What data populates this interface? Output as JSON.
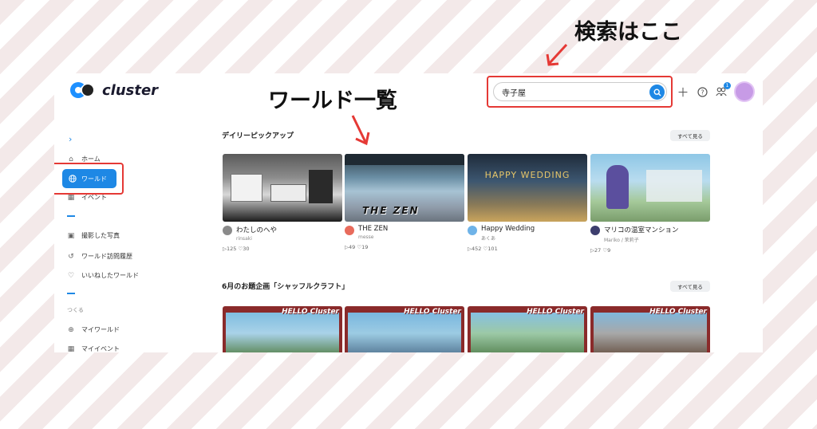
{
  "annotations": {
    "search_label": "検索はここ",
    "world_list_label": "ワールド一覧"
  },
  "header": {
    "logo_text": "cluster",
    "search_value": "寺子屋",
    "notification_count": "1"
  },
  "sidebar": {
    "items": [
      {
        "label": "ホーム",
        "icon": "home-icon"
      },
      {
        "label": "ワールド",
        "icon": "globe-icon",
        "active": true
      },
      {
        "label": "イベント",
        "icon": "calendar-icon"
      },
      {
        "label": "撮影した写真",
        "icon": "image-icon"
      },
      {
        "label": "ワールド訪問履歴",
        "icon": "history-icon"
      },
      {
        "label": "いいねしたワールド",
        "icon": "heart-icon"
      },
      {
        "label": "マイワールド",
        "icon": "globe-icon"
      },
      {
        "label": "マイイベント",
        "icon": "calendar-icon"
      }
    ],
    "section_create": "つくる"
  },
  "daily_pickup": {
    "title": "デイリーピックアップ",
    "see_all": "すべて見る",
    "cards": [
      {
        "title": "わたしのへや",
        "author": "rinsaki",
        "stats": "▷125 ♡30"
      },
      {
        "title": "THE ZEN",
        "author": "messe",
        "stats": "▷49 ♡19",
        "overlay": "THE ZEN"
      },
      {
        "title": "Happy Wedding",
        "author": "あくあ",
        "stats": "▷452 ♡101",
        "overlay": "HAPPY WEDDING"
      },
      {
        "title": "マリコの温室マンション",
        "author": "Mariko / 茉莉子",
        "stats": "▷27 ♡9"
      }
    ]
  },
  "june_project": {
    "title": "6月のお題企画「シャッフルクラフト」",
    "see_all": "すべて見る",
    "card_overlay": "HELLO Cluster"
  },
  "colors": {
    "accent": "#1e88e5",
    "annotation_red": "#e53935"
  }
}
